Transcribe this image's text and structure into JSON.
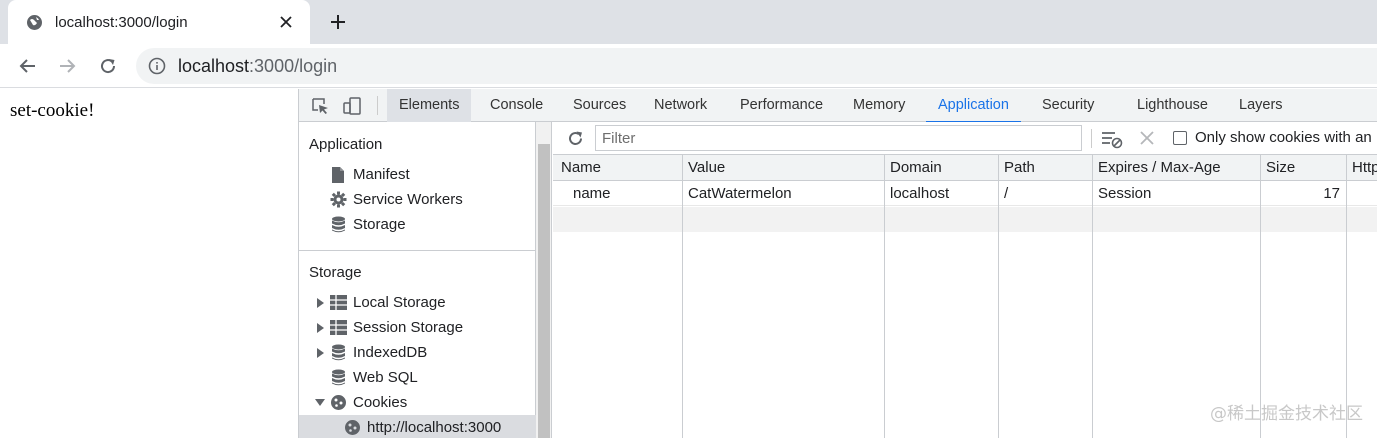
{
  "browser": {
    "tab_title": "localhost:3000/login",
    "omnibox_host": "localhost",
    "omnibox_path": ":3000/login"
  },
  "page": {
    "text": "set-cookie!"
  },
  "devtools": {
    "tabs": [
      "Elements",
      "Console",
      "Sources",
      "Network",
      "Performance",
      "Memory",
      "Application",
      "Security",
      "Lighthouse",
      "Layers"
    ],
    "active_tab": "Application",
    "sidebar": {
      "application_heading": "Application",
      "application_items": [
        "Manifest",
        "Service Workers",
        "Storage"
      ],
      "storage_heading": "Storage",
      "storage_items": [
        "Local Storage",
        "Session Storage",
        "IndexedDB",
        "Web SQL",
        "Cookies"
      ],
      "cookie_origin": "http://localhost:3000"
    },
    "cookie_toolbar": {
      "filter_placeholder": "Filter",
      "only_show_label": "Only show cookies with an"
    },
    "cookie_table": {
      "columns": [
        "Name",
        "Value",
        "Domain",
        "Path",
        "Expires / Max-Age",
        "Size",
        "Http"
      ],
      "rows": [
        {
          "name": "name",
          "value": "CatWatermelon",
          "domain": "localhost",
          "path": "/",
          "expires": "Session",
          "size": "17"
        }
      ]
    }
  },
  "watermark": "@稀土掘金技术社区"
}
